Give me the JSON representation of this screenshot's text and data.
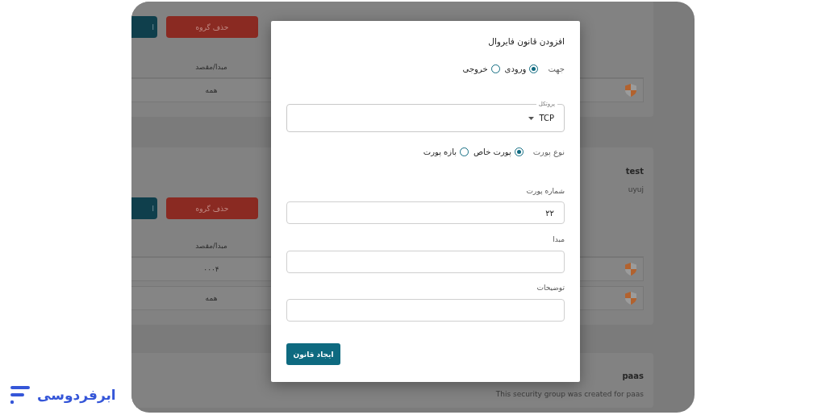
{
  "logo": {
    "text": "ابرفردوسی"
  },
  "background": {
    "cards": [
      {
        "buttons": [
          {
            "kind": "danger",
            "label": "حذف گروه"
          },
          {
            "kind": "primary",
            "label": "ا"
          }
        ],
        "column": "مبدا/مقصد",
        "rows": [
          "همه"
        ]
      },
      {
        "title": "test",
        "description": "uyuj",
        "buttons": [
          {
            "kind": "danger",
            "label": "حذف گروه"
          },
          {
            "kind": "primary",
            "label": "ا"
          }
        ],
        "column": "مبدا/مقصد",
        "rows": [
          "۰۰۰۴",
          "همه"
        ]
      },
      {
        "title": "paas",
        "description": "This security group was created for paas"
      }
    ]
  },
  "dialog": {
    "title": "افزودن قانون فایروال",
    "direction": {
      "label": "جهت",
      "options": [
        {
          "label": "ورودی",
          "selected": true
        },
        {
          "label": "خروجی",
          "selected": false
        }
      ]
    },
    "protocol": {
      "label": "پروتکل",
      "value": "TCP"
    },
    "port_type": {
      "label": "نوع پورت",
      "options": [
        {
          "label": "پورت خاص",
          "selected": true
        },
        {
          "label": "بازه پورت",
          "selected": false
        }
      ]
    },
    "fields": [
      {
        "label": "شماره پورت",
        "value": "۲۲"
      },
      {
        "label": "مبدا"
      },
      {
        "label": "توضیحات"
      }
    ],
    "submit": "ایجاد قانون"
  }
}
